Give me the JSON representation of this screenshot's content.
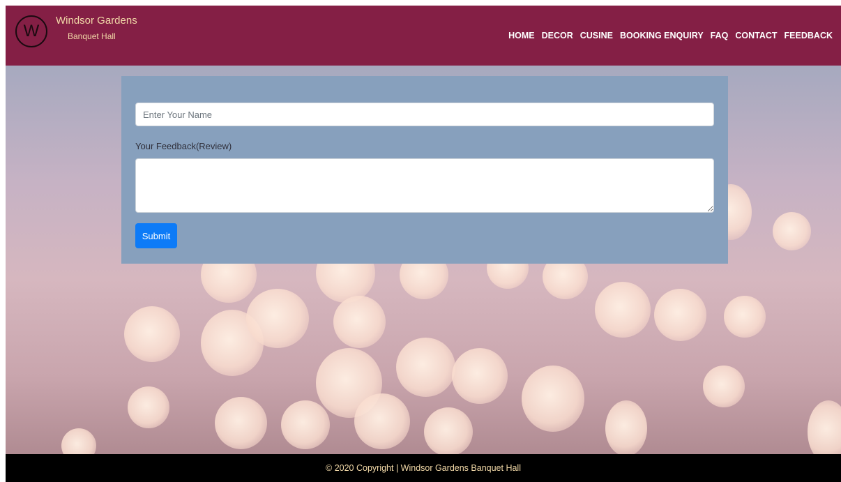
{
  "header": {
    "logo_letter": "W",
    "brand_name": "Windsor Gardens",
    "brand_sub": "Banquet Hall",
    "bg_color": "#841f45"
  },
  "nav": {
    "items": [
      {
        "label": "HOME"
      },
      {
        "label": "DECOR"
      },
      {
        "label": "CUSINE"
      },
      {
        "label": "BOOKING ENQUIRY"
      },
      {
        "label": "FAQ"
      },
      {
        "label": "CONTACT"
      },
      {
        "label": "FEEDBACK"
      }
    ]
  },
  "form": {
    "name_placeholder": "Enter Your Name",
    "name_value": "",
    "feedback_label": "Your Feedback(Review)",
    "feedback_value": "",
    "submit_label": "Submit",
    "panel_color": "#87a0bd",
    "button_color": "#0d7bf7"
  },
  "footer": {
    "text": "© 2020 Copyright | Windsor Gardens Banquet Hall"
  }
}
